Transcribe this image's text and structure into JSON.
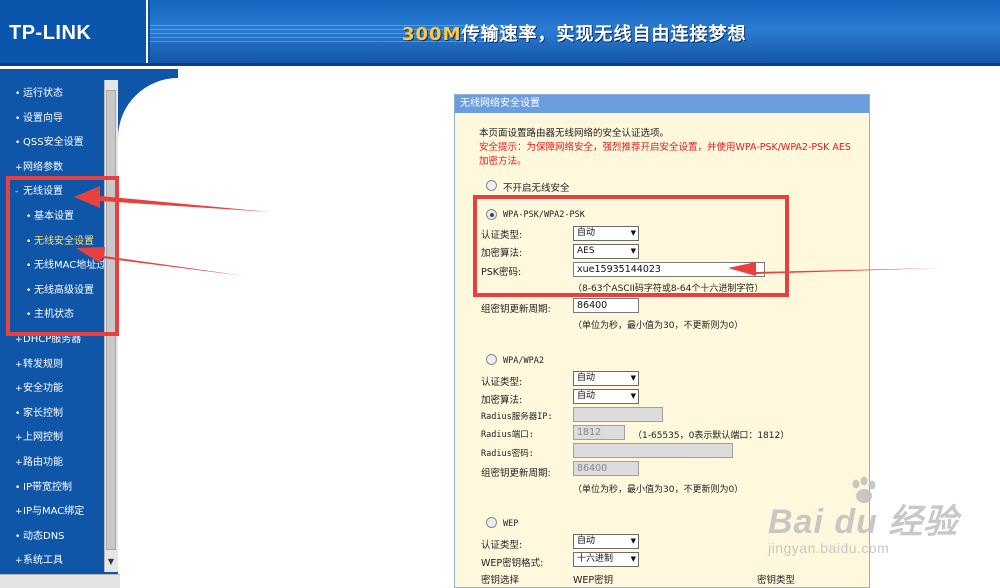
{
  "header": {
    "logo": "TP-LINK",
    "banner_accent": "300M",
    "banner_text": "传输速率，实现无线自由连接梦想"
  },
  "sidebar": {
    "items": [
      {
        "label": "运行状态",
        "bullet": "•",
        "sub": false,
        "active": false
      },
      {
        "label": "设置向导",
        "bullet": "•",
        "sub": false,
        "active": false
      },
      {
        "label": "QSS安全设置",
        "bullet": "•",
        "sub": false,
        "active": false
      },
      {
        "label": "网络参数",
        "bullet": "+",
        "sub": false,
        "active": false
      },
      {
        "label": "无线设置",
        "bullet": "-",
        "sub": false,
        "active": false
      },
      {
        "label": "基本设置",
        "bullet": "•",
        "sub": true,
        "active": false
      },
      {
        "label": "无线安全设置",
        "bullet": "•",
        "sub": true,
        "active": true
      },
      {
        "label": "无线MAC地址过滤",
        "bullet": "•",
        "sub": true,
        "active": false
      },
      {
        "label": "无线高级设置",
        "bullet": "•",
        "sub": true,
        "active": false
      },
      {
        "label": "主机状态",
        "bullet": "•",
        "sub": true,
        "active": false
      },
      {
        "label": "DHCP服务器",
        "bullet": "+",
        "sub": false,
        "active": false
      },
      {
        "label": "转发规则",
        "bullet": "+",
        "sub": false,
        "active": false
      },
      {
        "label": "安全功能",
        "bullet": "+",
        "sub": false,
        "active": false
      },
      {
        "label": "家长控制",
        "bullet": "•",
        "sub": false,
        "active": false
      },
      {
        "label": "上网控制",
        "bullet": "+",
        "sub": false,
        "active": false
      },
      {
        "label": "路由功能",
        "bullet": "+",
        "sub": false,
        "active": false
      },
      {
        "label": "IP带宽控制",
        "bullet": "•",
        "sub": false,
        "active": false
      },
      {
        "label": "IP与MAC绑定",
        "bullet": "+",
        "sub": false,
        "active": false
      },
      {
        "label": "动态DNS",
        "bullet": "•",
        "sub": false,
        "active": false
      },
      {
        "label": "系统工具",
        "bullet": "+",
        "sub": false,
        "active": false
      }
    ]
  },
  "panel": {
    "title": "无线网络安全设置",
    "intro": "本页面设置路由器无线网络的安全认证选项。",
    "warning_line1": "安全提示：为保障网络安全，强烈推荐开启安全设置，并使用WPA-PSK/WPA2-PSK AES",
    "warning_line2": "加密方法。",
    "option_off": "不开启无线安全",
    "wpa_psk": {
      "title": "WPA-PSK/WPA2-PSK",
      "auth_label": "认证类型:",
      "auth_value": "自动",
      "enc_label": "加密算法:",
      "enc_value": "AES",
      "psk_label": "PSK密码:",
      "psk_value": "xue15935144023",
      "psk_hint": "（8-63个ASCII码字符或8-64个十六进制字符）",
      "renew_label": "组密钥更新周期:",
      "renew_value": "86400",
      "renew_hint": "（单位为秒，最小值为30，不更新则为0）"
    },
    "wpa": {
      "title": "WPA/WPA2",
      "auth_label": "认证类型:",
      "auth_value": "自动",
      "enc_label": "加密算法:",
      "enc_value": "自动",
      "radius_ip_label": "Radius服务器IP:",
      "radius_ip_value": "",
      "radius_port_label": "Radius端口:",
      "radius_port_value": "1812",
      "radius_port_hint": "（1-65535，0表示默认端口：1812）",
      "radius_pwd_label": "Radius密码:",
      "radius_pwd_value": "",
      "renew_label": "组密钥更新周期:",
      "renew_value": "86400",
      "renew_hint": "（单位为秒，最小值为30，不更新则为0）"
    },
    "wep": {
      "title": "WEP",
      "auth_label": "认证类型:",
      "auth_value": "自动",
      "format_label": "WEP密钥格式:",
      "format_value": "十六进制",
      "col_select": "密钥选择",
      "col_key": "WEP密钥",
      "col_type": "密钥类型"
    }
  },
  "watermark": {
    "big": "Bai du 经验",
    "small": "jingyan.baidu.com"
  },
  "colors": {
    "header_blue": "#0b4f9f",
    "sidebar_blue": "#0f56a8",
    "panel_bg": "#fff8dd",
    "panel_title_bg": "#6a9ede",
    "highlight_red": "#e8403f",
    "banner_accent": "#ffc93c",
    "active_menu": "#ffe066"
  }
}
